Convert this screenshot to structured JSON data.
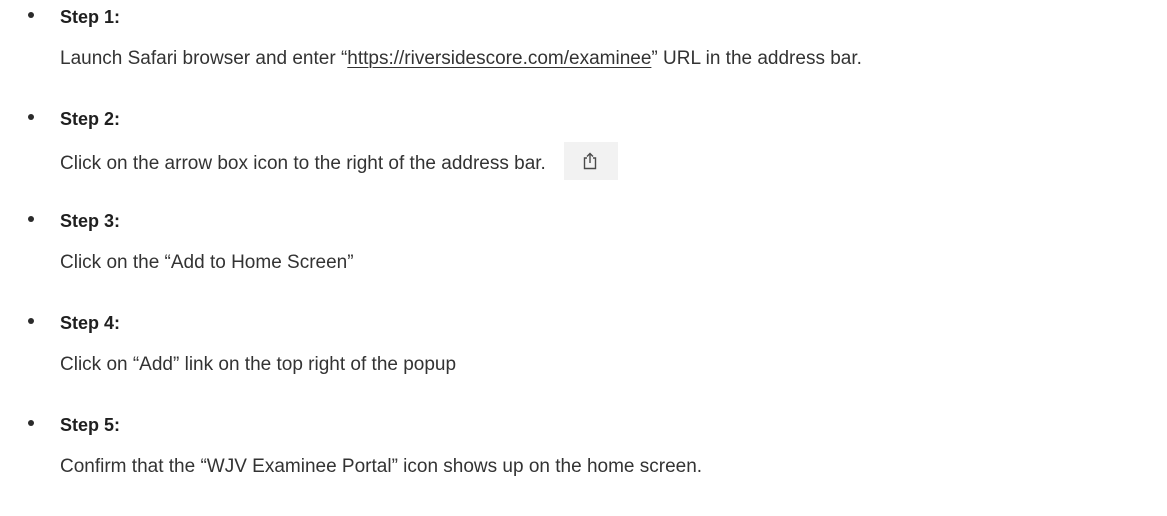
{
  "steps": [
    {
      "title": "Step 1:",
      "text_before": "Launch Safari browser and enter “",
      "link": "https://riversidescore.com/examinee",
      "text_after": "” URL in the address bar."
    },
    {
      "title": "Step 2:",
      "text": "Click on the arrow box icon to the right of the address bar.",
      "icon": "share-icon"
    },
    {
      "title": "Step 3:",
      "text": "Click on the “Add to Home Screen”"
    },
    {
      "title": "Step 4:",
      "text": "Click on “Add” link on the top right of the popup"
    },
    {
      "title": "Step 5:",
      "text": "Confirm that the “WJV Examinee Portal” icon shows up on the home screen."
    }
  ]
}
